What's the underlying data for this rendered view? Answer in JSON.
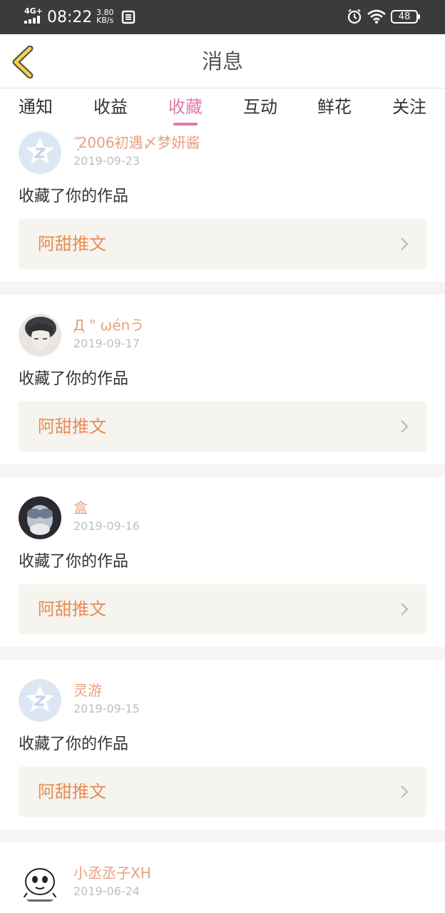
{
  "status_bar": {
    "network": "4G+",
    "time": "08:22",
    "speed_value": "3.80",
    "speed_unit": "KB/s",
    "battery": "48"
  },
  "header": {
    "title": "消息"
  },
  "tabs": [
    {
      "label": "通知"
    },
    {
      "label": "收益"
    },
    {
      "label": "收藏"
    },
    {
      "label": "互动"
    },
    {
      "label": "鲜花"
    },
    {
      "label": "关注"
    }
  ],
  "active_tab": "收藏",
  "colors": {
    "accent_pink": "#e07aa8",
    "username_orange": "#e6a27f",
    "work_title_orange": "#e98b55"
  },
  "notifications": [
    {
      "username": "ˉ͛‍ͅ2006初遇〆梦妍酱",
      "date": "2019-09-23",
      "action": "收藏了你的作品",
      "work_title": "阿甜推文",
      "avatar": "qq-default-avatar"
    },
    {
      "username": "Д \" ωénう",
      "date": "2019-09-17",
      "action": "收藏了你的作品",
      "work_title": "阿甜推文",
      "avatar": "photo-avatar"
    },
    {
      "username": "盒",
      "date": "2019-09-16",
      "action": "收藏了你的作品",
      "work_title": "阿甜推文",
      "avatar": "dark-photo-avatar"
    },
    {
      "username": "灵游",
      "date": "2019-09-15",
      "action": "收藏了你的作品",
      "work_title": "阿甜推文",
      "avatar": "qq-default-avatar"
    },
    {
      "username": "小丞丞子XH",
      "date": "2019-06-24",
      "action": "",
      "work_title": "",
      "avatar": "cartoon-face-avatar"
    }
  ]
}
